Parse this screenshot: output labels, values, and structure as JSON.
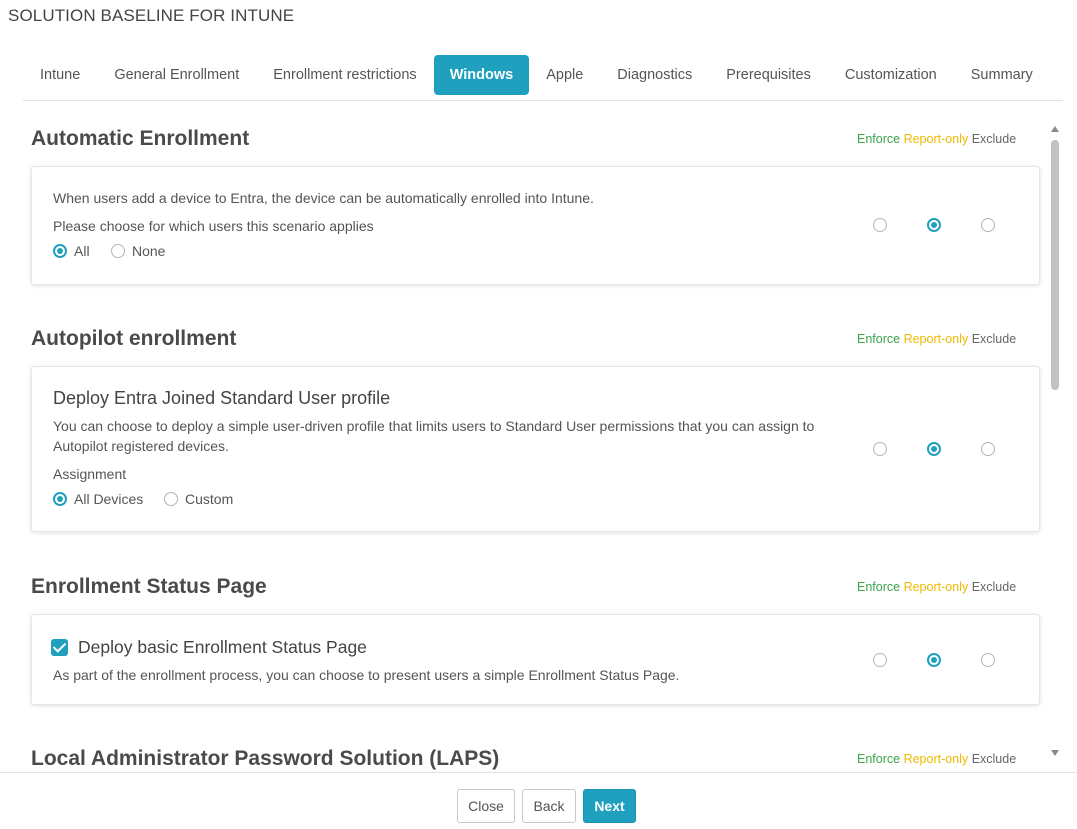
{
  "page": {
    "title": "SOLUTION BASELINE FOR INTUNE"
  },
  "tabs": [
    {
      "label": "Intune"
    },
    {
      "label": "General Enrollment"
    },
    {
      "label": "Enrollment restrictions"
    },
    {
      "label": "Windows",
      "active": true
    },
    {
      "label": "Apple"
    },
    {
      "label": "Diagnostics"
    },
    {
      "label": "Prerequisites"
    },
    {
      "label": "Customization"
    },
    {
      "label": "Summary"
    }
  ],
  "modes": {
    "enforce": "Enforce",
    "report_only": "Report-only",
    "exclude": "Exclude"
  },
  "sections": {
    "auto_enrollment": {
      "title": "Automatic Enrollment",
      "description": "When users add a device to Entra, the device can be automatically enrolled into Intune.",
      "question": "Please choose for which users this scenario applies",
      "options": [
        "All",
        "None"
      ],
      "selected_option": "All",
      "selected_mode": "Report-only"
    },
    "autopilot": {
      "title": "Autopilot enrollment",
      "heading": "Deploy Entra Joined Standard User profile",
      "description": "You can choose to deploy a simple user-driven profile that limits users to Standard User permissions that you can assign to Autopilot registered devices.",
      "assignment_label": "Assignment",
      "options": [
        "All Devices",
        "Custom"
      ],
      "selected_option": "All Devices",
      "selected_mode": "Report-only"
    },
    "esp": {
      "title": "Enrollment Status Page",
      "checkbox_label": "Deploy basic Enrollment Status Page",
      "checked": true,
      "description": "As part of the enrollment process, you can choose to present users a simple Enrollment Status Page.",
      "selected_mode": "Report-only"
    },
    "laps": {
      "title": "Local Administrator Password Solution (LAPS)"
    }
  },
  "footer": {
    "close_label": "Close",
    "back_label": "Back",
    "next_label": "Next"
  },
  "colors": {
    "accent": "#1fa0bf",
    "enforce": "#3aa54a",
    "report_only": "#f0b800",
    "exclude": "#666666"
  }
}
